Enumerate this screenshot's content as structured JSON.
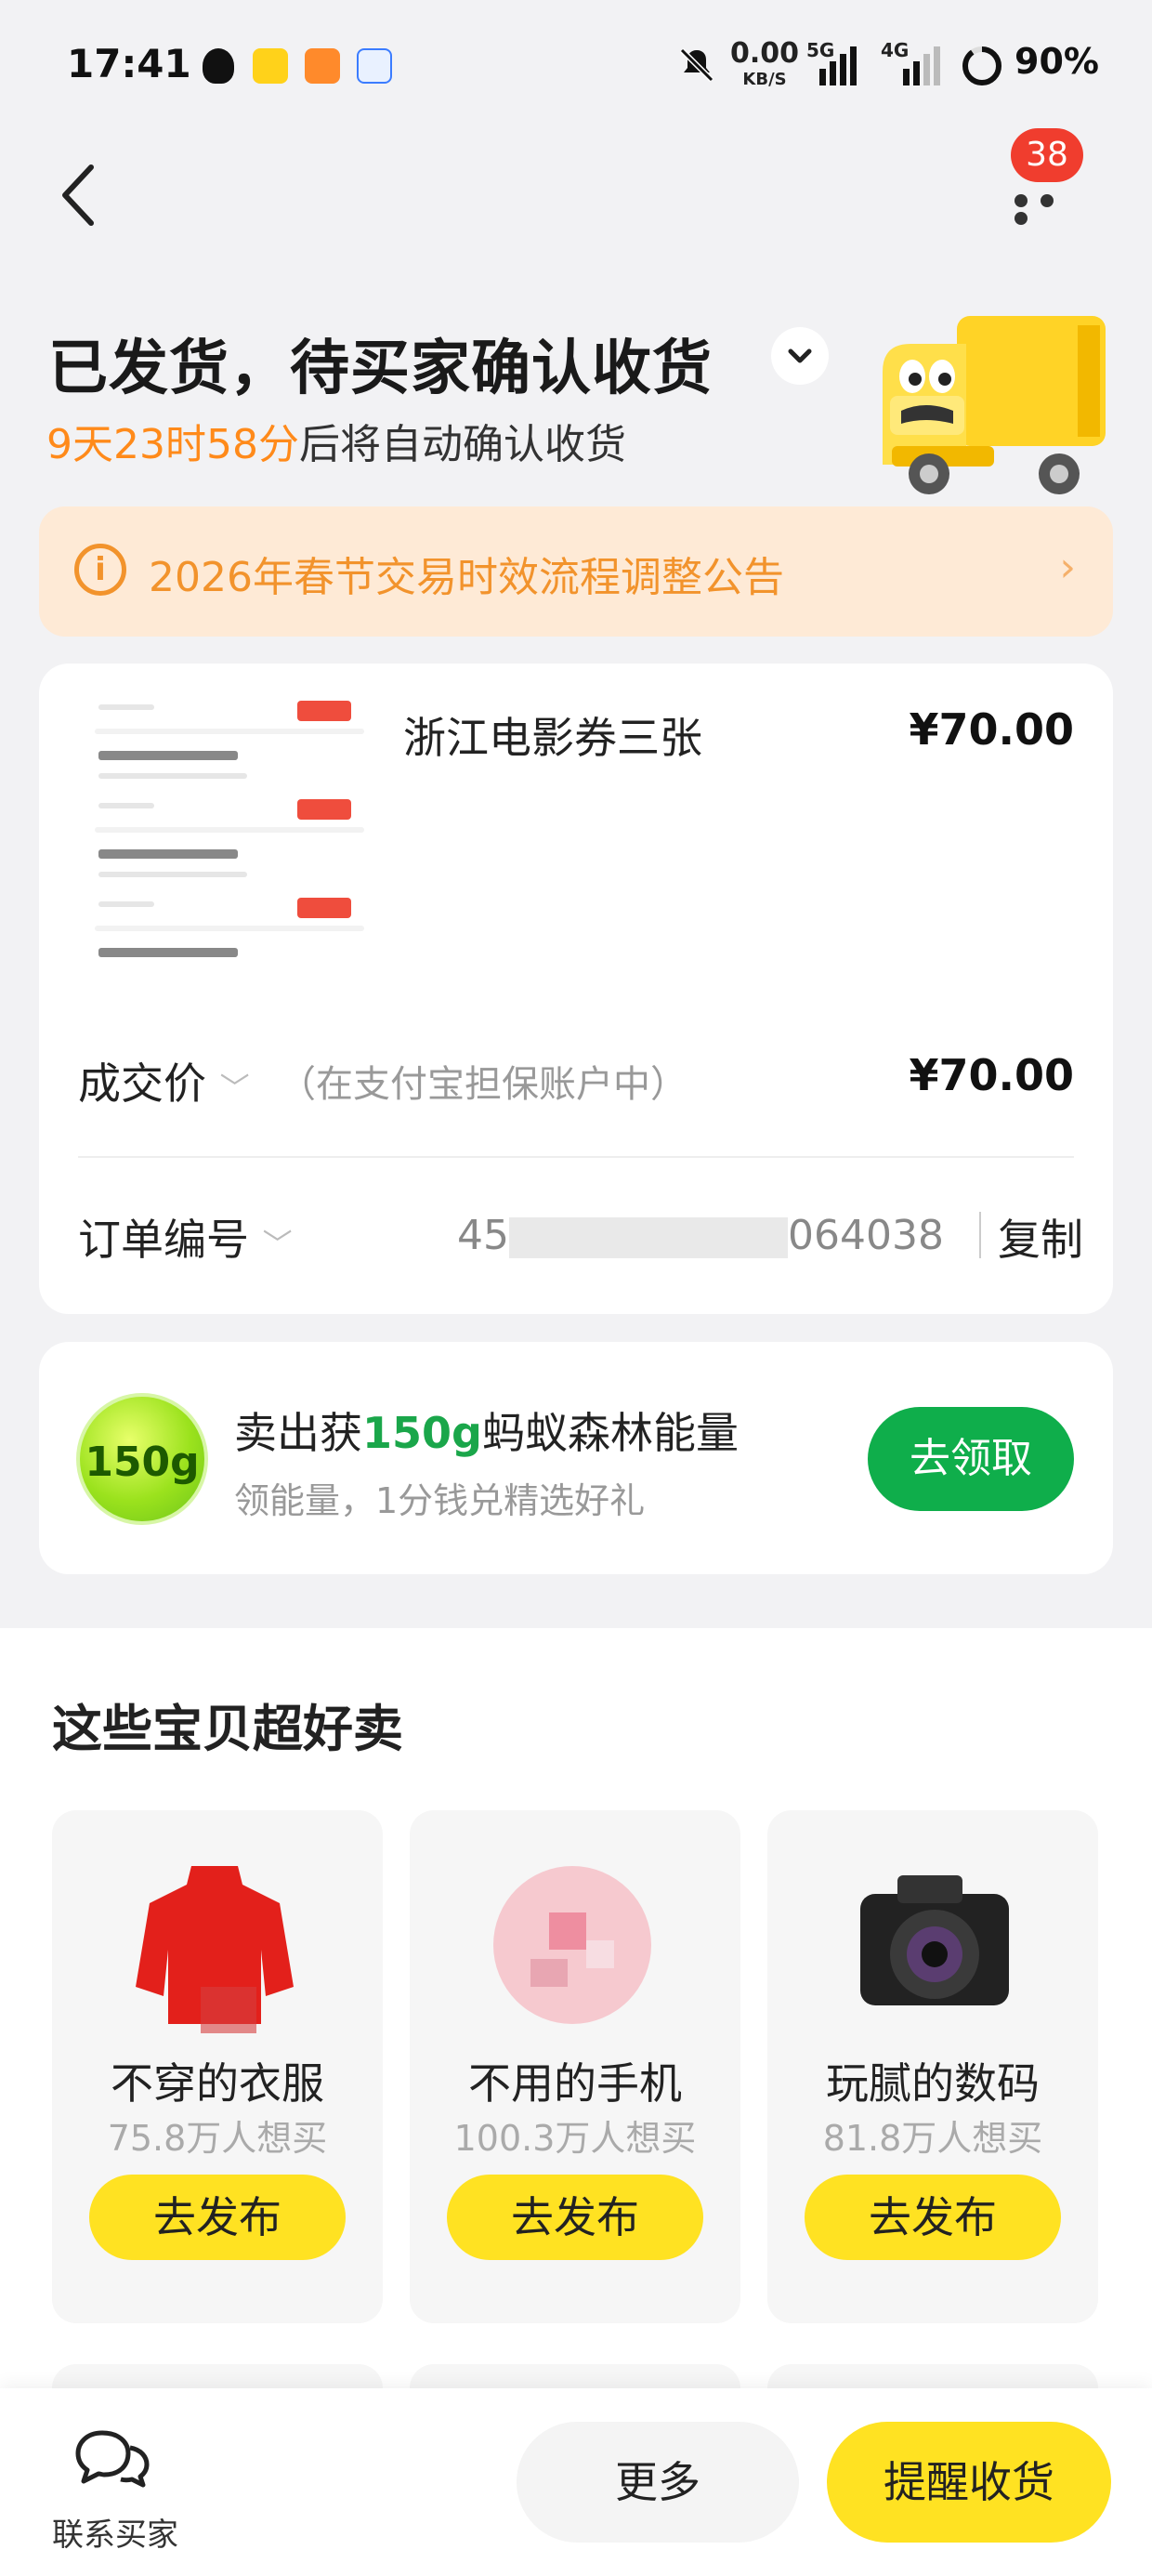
{
  "status_bar": {
    "time": "17:41",
    "network_speed": "0.00",
    "network_unit": "KB/S",
    "signal1": "5G",
    "signal2": "4G",
    "battery": "90%"
  },
  "header": {
    "badge_count": "38",
    "status_title": "已发货，待买家确认收货",
    "countdown": "9天23时58分",
    "countdown_suffix": "后将自动确认收货"
  },
  "notice": {
    "text": "2026年春节交易时效流程调整公告"
  },
  "order": {
    "product_name": "浙江电影券三张",
    "product_price": "¥70.00",
    "deal_price_label": "成交价",
    "deal_price_hint": "（在支付宝担保账户中）",
    "deal_price": "¥70.00",
    "order_no_label": "订单编号",
    "order_no_start": "45",
    "order_no_end": "064038",
    "copy_label": "复制"
  },
  "energy": {
    "ball_text": "150g",
    "title_prefix": "卖出获",
    "title_highlight": "150g",
    "title_suffix": "蚂蚁森林能量",
    "subtitle": "领能量，1分钱兑精选好礼",
    "button": "去领取"
  },
  "recommend": {
    "title": "这些宝贝超好卖",
    "items": [
      {
        "name": "不穿的衣服",
        "count": "75.8万人想买",
        "button": "去发布"
      },
      {
        "name": "不用的手机",
        "count": "100.3万人想买",
        "button": "去发布"
      },
      {
        "name": "玩腻的数码",
        "count": "81.8万人想买",
        "button": "去发布"
      }
    ]
  },
  "bottom": {
    "contact_label": "联系买家",
    "more_label": "更多",
    "remind_label": "提醒收货"
  },
  "colors": {
    "accent_yellow": "#ffe222",
    "countdown_orange": "#ff8a1a",
    "energy_green": "#0fae4b",
    "badge_red": "#f03d2e"
  }
}
